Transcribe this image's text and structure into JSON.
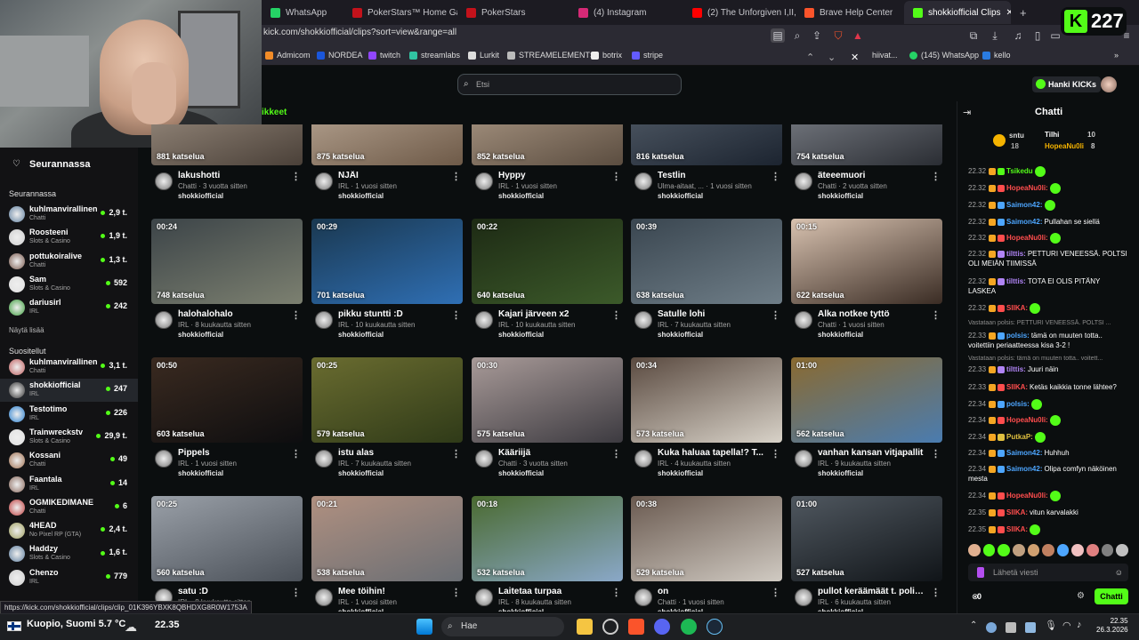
{
  "browser": {
    "tabs": [
      {
        "label": "WhatsApp",
        "color": "#25d366"
      },
      {
        "label": "PokerStars™ Home Games",
        "color": "#c3121b"
      },
      {
        "label": "PokerStars",
        "color": "#c3121b"
      },
      {
        "label": "(4) Instagram",
        "color": "#d62976"
      },
      {
        "label": "(2) The Unforgiven I,II,III -",
        "color": "#ff0000"
      },
      {
        "label": "Brave Help Center",
        "color": "#fb542b"
      },
      {
        "label": "shokkiofficial Clips",
        "color": "#53fc18"
      }
    ],
    "url": "kick.com/shokkiofficial/clips?sort=view&range=all",
    "bookmarks": [
      "Admicom",
      "NORDEA",
      "twitch",
      "streamlabs",
      "Lurkit",
      "STREAMELEMENTS",
      "botrix",
      "stripe",
      "hiivat...",
      "(145) WhatsApp",
      "kello"
    ],
    "status_url": "https://kick.com/shokkiofficial/clips/clip_01K396YBXK8QBHDXG8R0W1753A"
  },
  "overlay": {
    "kick_letter": "K",
    "kick_count": "227"
  },
  "header": {
    "search_placeholder": "Etsi",
    "hanki_kicks": "Hanki KICKs",
    "clips_heading": "ikkeet"
  },
  "sidebar": {
    "following_title": "Seurannassa",
    "following_section": "Seurannassa",
    "following": [
      {
        "name": "kuhlmanvirallinen",
        "category": "Chatti",
        "viewers": "2,9 t."
      },
      {
        "name": "Roosteeni",
        "category": "Slots & Casino",
        "viewers": "1,9 t."
      },
      {
        "name": "pottukoiralive",
        "category": "Chatti",
        "viewers": "1,3 t."
      },
      {
        "name": "Sam",
        "category": "Slots & Casino",
        "viewers": "592"
      },
      {
        "name": "dariusirl",
        "category": "IRL",
        "viewers": "242"
      }
    ],
    "show_more": "Näytä lisää",
    "suggested_section": "Suositellut",
    "suggested": [
      {
        "name": "kuhlmanvirallinen",
        "category": "Chatti",
        "viewers": "3,1 t."
      },
      {
        "name": "shokkiofficial",
        "category": "IRL",
        "viewers": "247"
      },
      {
        "name": "Testotimo",
        "category": "IRL",
        "viewers": "226"
      },
      {
        "name": "Trainwreckstv",
        "category": "Slots & Casino",
        "viewers": "29,9 t."
      },
      {
        "name": "Kossani",
        "category": "Chatti",
        "viewers": "49"
      },
      {
        "name": "Faantala",
        "category": "IRL",
        "viewers": "14"
      },
      {
        "name": "OGMIKEDIMANE",
        "category": "Chatti",
        "viewers": "6"
      },
      {
        "name": "4HEAD",
        "category": "No Pixel RP (GTA)",
        "viewers": "2,4 t."
      },
      {
        "name": "Haddzy",
        "category": "Slots & Casino",
        "viewers": "1,6 t."
      },
      {
        "name": "Chenzo",
        "category": "IRL",
        "viewers": "779"
      }
    ]
  },
  "clips": [
    {
      "duration": "",
      "views": "881 katselua",
      "title": "lakushotti",
      "meta": "Chatti · 3 vuotta sitten",
      "channel": "shokkiofficial",
      "c1": "#4a4038",
      "c2": "#a89a8c"
    },
    {
      "duration": "",
      "views": "875 katselua",
      "title": "NJÄI",
      "meta": "IRL · 1 vuosi sitten",
      "channel": "shokkiofficial",
      "c1": "#6e5a48",
      "c2": "#c4b2a0"
    },
    {
      "duration": "",
      "views": "852 katselua",
      "title": "Hyppy",
      "meta": "IRL · 1 vuosi sitten",
      "channel": "shokkiofficial",
      "c1": "#5b4d40",
      "c2": "#b8a490"
    },
    {
      "duration": "",
      "views": "816 katselua",
      "title": "Testlin",
      "meta": "Ulma-aitaat, ... · 1 vuosi sitten",
      "channel": "shokkiofficial",
      "c1": "#1c2430",
      "c2": "#5a6470"
    },
    {
      "duration": "",
      "views": "754 katselua",
      "title": "äteeemuori",
      "meta": "Chatti · 2 vuotta sitten",
      "channel": "shokkiofficial",
      "c1": "#2a2d33",
      "c2": "#8a8e96"
    },
    {
      "duration": "00:24",
      "views": "748 katselua",
      "title": "halohalohalo",
      "meta": "IRL · 8 kuukautta sitten",
      "channel": "shokkiofficial",
      "c1": "#7c8070",
      "c2": "#3c4448"
    },
    {
      "duration": "00:29",
      "views": "701 katselua",
      "title": "pikku stuntti :D",
      "meta": "IRL · 10 kuukautta sitten",
      "channel": "shokkiofficial",
      "c1": "#2f6fb4",
      "c2": "#1a3850"
    },
    {
      "duration": "00:22",
      "views": "640 katselua",
      "title": "Kajari järveen x2",
      "meta": "IRL · 10 kuukautta sitten",
      "channel": "shokkiofficial",
      "c1": "#3c5a2a",
      "c2": "#1d2a14"
    },
    {
      "duration": "00:39",
      "views": "638 katselua",
      "title": "Satulle lohi",
      "meta": "IRL · 7 kuukautta sitten",
      "channel": "shokkiofficial",
      "c1": "#6f7e88",
      "c2": "#3a4650"
    },
    {
      "duration": "00:15",
      "views": "622 katselua",
      "title": "Alka notkee tyttö",
      "meta": "Chatti · 1 vuosi sitten",
      "channel": "shokkiofficial",
      "c1": "#3a2c24",
      "c2": "#d8c2b0"
    },
    {
      "duration": "00:50",
      "views": "603 katselua",
      "title": "Pippels",
      "meta": "IRL · 1 vuosi sitten",
      "channel": "shokkiofficial",
      "c1": "#0d0d0f",
      "c2": "#3a2a20"
    },
    {
      "duration": "00:25",
      "views": "579 katselua",
      "title": "istu alas",
      "meta": "IRL · 7 kuukautta sitten",
      "channel": "shokkiofficial",
      "c1": "#2f3a18",
      "c2": "#6a6c30"
    },
    {
      "duration": "00:30",
      "views": "575 katselua",
      "title": "Kääriijä",
      "meta": "Chatti · 3 vuotta sitten",
      "channel": "shokkiofficial",
      "c1": "#3c3a40",
      "c2": "#a89a98"
    },
    {
      "duration": "00:34",
      "views": "573 katselua",
      "title": "Kuka haluaa tapella!? T...",
      "meta": "IRL · 4 kuukautta sitten",
      "channel": "shokkiofficial",
      "c1": "#d8d2c8",
      "c2": "#5a4a40"
    },
    {
      "duration": "01:00",
      "views": "562 katselua",
      "title": "vanhan kansan vitjapallit",
      "meta": "IRL · 9 kuukautta sitten",
      "channel": "shokkiofficial",
      "c1": "#4a7cb0",
      "c2": "#8a6a30"
    },
    {
      "duration": "00:25",
      "views": "560 katselua",
      "title": "satu :D",
      "meta": "IRL · 8 kuukautta sitten",
      "channel": "shokkiofficial",
      "c1": "#4a5058",
      "c2": "#9aa0a8"
    },
    {
      "duration": "00:21",
      "views": "538 katselua",
      "title": "Mee töihin!",
      "meta": "IRL · 1 vuosi sitten",
      "channel": "shokkiofficial",
      "c1": "#6a6e74",
      "c2": "#b09080"
    },
    {
      "duration": "00:18",
      "views": "532 katselua",
      "title": "Laitetaa turpaa",
      "meta": "IRL · 8 kuukautta sitten",
      "channel": "shokkiofficial",
      "c1": "#8aa8c8",
      "c2": "#4a6a30"
    },
    {
      "duration": "00:38",
      "views": "529 katselua",
      "title": "on",
      "meta": "Chatti · 1 vuosi sitten",
      "channel": "shokkiofficial",
      "c1": "#d0cac2",
      "c2": "#6a5a50"
    },
    {
      "duration": "01:00",
      "views": "527 katselua",
      "title": "pullot keräämäät t. polii...",
      "meta": "IRL · 6 kuukautta sitten",
      "channel": "shokkiofficial",
      "c1": "#101418",
      "c2": "#505860"
    }
  ],
  "chat": {
    "title": "Chatti",
    "pinned": {
      "user1": "Tilhi",
      "count1": "10",
      "user2": "HopeaNu0li",
      "count2": "8",
      "label": "sntu",
      "num": "18"
    },
    "messages": [
      {
        "time": "22.32",
        "user": "Tsikedu",
        "color": "#53fc18",
        "text": ""
      },
      {
        "time": "22.32",
        "user": "HopeaNu0li:",
        "color": "#ff4d4d",
        "text": ""
      },
      {
        "time": "22.32",
        "user": "Saimon42:",
        "color": "#4da6ff",
        "text": ""
      },
      {
        "time": "22.32",
        "user": "Saimon42:",
        "color": "#4da6ff",
        "text": "Pullahan se siellä"
      },
      {
        "time": "22.32",
        "user": "HopeaNu0li:",
        "color": "#ff4d4d",
        "text": ""
      },
      {
        "time": "22.32",
        "user": "tilttis:",
        "color": "#b084f5",
        "text": "PETTURI VENEESSÄ. POLTSI OLI MEIÄN TIIMISSÄ"
      },
      {
        "time": "22.32",
        "user": "tilttis:",
        "color": "#b084f5",
        "text": "TOTA EI OLIS PITÄNY LASKEA"
      },
      {
        "time": "22.32",
        "user": "SIIKA:",
        "color": "#ff4d4d",
        "text": ""
      },
      {
        "time": "22.33",
        "user": "polsis:",
        "color": "#4da6ff",
        "text": "tämä on muuten totta.. voitettiin periaatteessa kisa 3-2 !"
      },
      {
        "time": "22.33",
        "user": "tilttis:",
        "color": "#b084f5",
        "text": "Juuri näin"
      },
      {
        "time": "22.33",
        "user": "SIIKA:",
        "color": "#ff4d4d",
        "text": "Ketäs kaikkia tonne lähtee?"
      },
      {
        "time": "22.34",
        "user": "polsis:",
        "color": "#4da6ff",
        "text": ""
      },
      {
        "time": "22.34",
        "user": "HopeaNu0li:",
        "color": "#ff4d4d",
        "text": ""
      },
      {
        "time": "22.34",
        "user": "PutkaP:",
        "color": "#e0c040",
        "text": ""
      },
      {
        "time": "22.34",
        "user": "Saimon42:",
        "color": "#4da6ff",
        "text": "Huhhuh"
      },
      {
        "time": "22.34",
        "user": "Saimon42:",
        "color": "#4da6ff",
        "text": "Olipa comfyn näköinen mesta"
      },
      {
        "time": "22.34",
        "user": "HopeaNu0li:",
        "color": "#ff4d4d",
        "text": ""
      },
      {
        "time": "22.35",
        "user": "SIIKA:",
        "color": "#ff4d4d",
        "text": "vitun karvalakki"
      },
      {
        "time": "22.35",
        "user": "SIIKA:",
        "color": "#ff4d4d",
        "text": ""
      }
    ],
    "reply1": "Vastataan polsis: PETTURI VENEESSÄ. POLTSI ...",
    "reply2": "Vastataan polsis: tämä on muuten totta.. voitett...",
    "input_placeholder": "Lähetä viesti",
    "points": "0",
    "send_label": "Chatti"
  },
  "taskbar": {
    "weather": "Kuopio, Suomi  5.7 °C",
    "clock_left": "22.35",
    "search_label": "Hae",
    "time": "22.35",
    "date": "26.3.2026"
  }
}
